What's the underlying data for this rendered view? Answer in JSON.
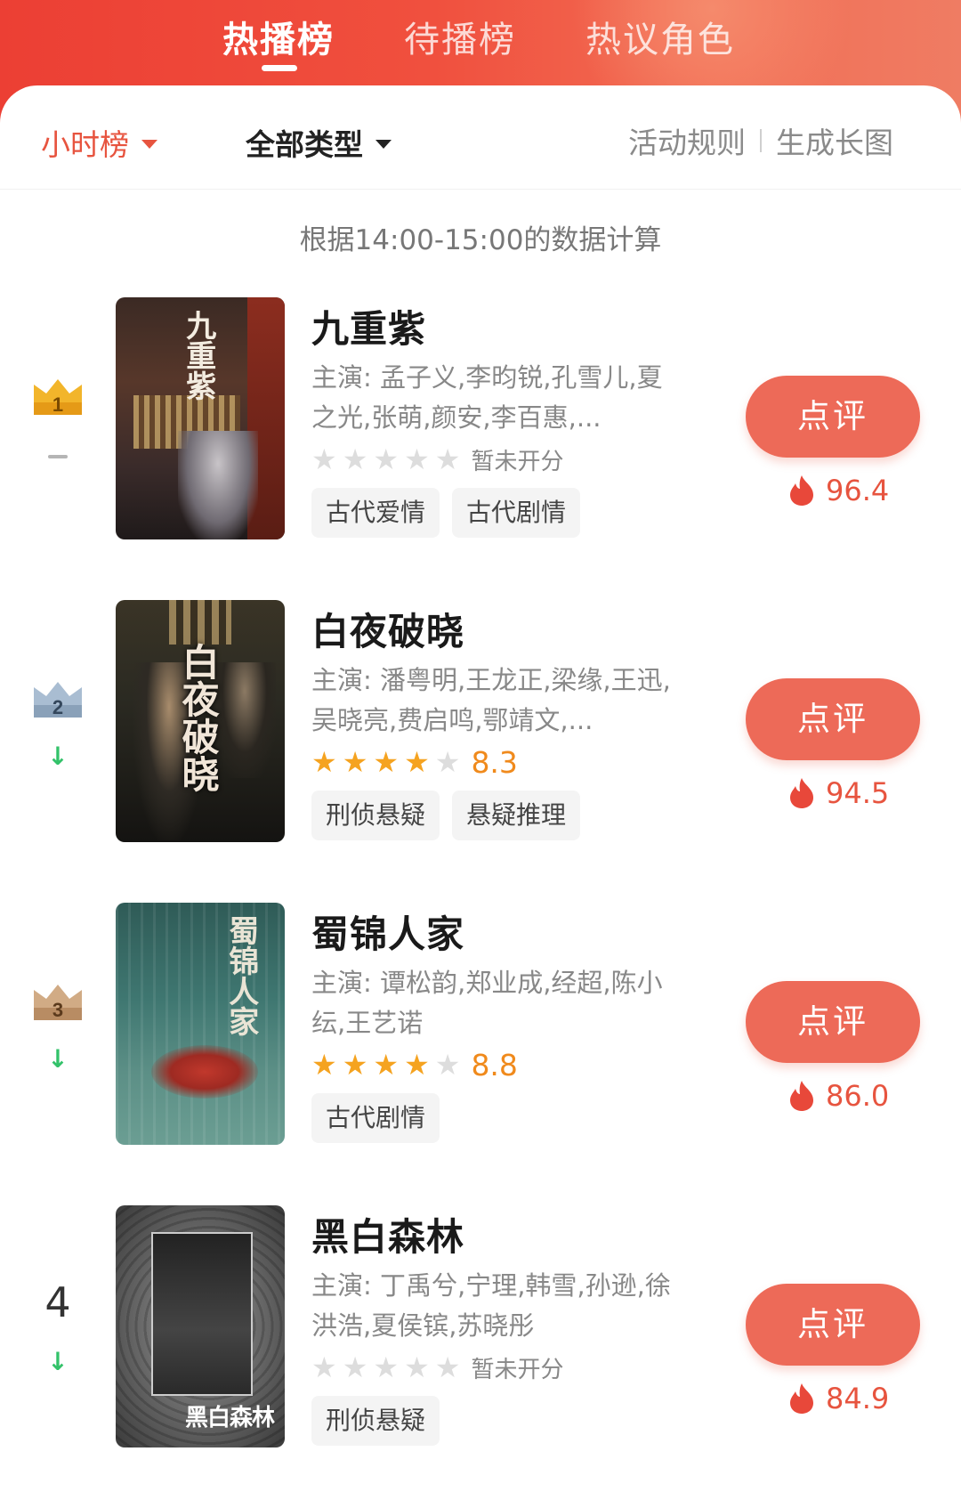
{
  "tabs": [
    {
      "label": "热播榜",
      "active": true
    },
    {
      "label": "待播榜",
      "active": false
    },
    {
      "label": "热议角色",
      "active": false
    }
  ],
  "filters": {
    "period": "小时榜",
    "category": "全部类型",
    "rules_link": "活动规则",
    "long_image_link": "生成长图"
  },
  "note": "根据14:00-15:00的数据计算",
  "items": [
    {
      "rank": "1",
      "trend": "same",
      "title": "九重紫",
      "cast": "主演: 孟子义,李昀锐,孔雪儿,夏之光,张萌,颜安,李百惠,...",
      "stars": 0,
      "score": "暂未开分",
      "rated": false,
      "tags": [
        "古代爱情",
        "古代剧情"
      ],
      "review_label": "点评",
      "heat": "96.4",
      "poster_text": "九重紫"
    },
    {
      "rank": "2",
      "trend": "down",
      "title": "白夜破晓",
      "cast": "主演: 潘粤明,王龙正,梁缘,王迅,吴晓亮,费启鸣,鄂靖文,...",
      "stars": 4,
      "score": "8.3",
      "rated": true,
      "tags": [
        "刑侦悬疑",
        "悬疑推理"
      ],
      "review_label": "点评",
      "heat": "94.5",
      "poster_text": "白夜破晓"
    },
    {
      "rank": "3",
      "trend": "down",
      "title": "蜀锦人家",
      "cast": "主演: 谭松韵,郑业成,经超,陈小纭,王艺诺",
      "stars": 4,
      "score": "8.8",
      "rated": true,
      "tags": [
        "古代剧情"
      ],
      "review_label": "点评",
      "heat": "86.0",
      "poster_text": "蜀锦人家"
    },
    {
      "rank": "4",
      "trend": "down",
      "title": "黑白森林",
      "cast": "主演: 丁禹兮,宁理,韩雪,孙逊,徐洪浩,夏侯镔,苏晓彤",
      "stars": 0,
      "score": "暂未开分",
      "rated": false,
      "tags": [
        "刑侦悬疑"
      ],
      "review_label": "点评",
      "heat": "84.9",
      "poster_text": "黑白森林"
    }
  ],
  "colors": {
    "header_red": "#ec3f34",
    "accent": "#e7543f",
    "button": "#ed6a58",
    "star_on": "#f5a320",
    "score": "#f08a1c",
    "trend_down": "#33c26a",
    "crown_gold": "#f2b52b",
    "crown_silver": "#9fb3c8",
    "crown_bronze": "#c9a27c"
  },
  "icons": {
    "period_caret": "caret-down-icon",
    "category_caret": "caret-down-icon",
    "heat": "flame-icon",
    "rank_1": "crown-gold-icon",
    "rank_2": "crown-silver-icon",
    "rank_3": "crown-bronze-icon",
    "trend_down": "arrow-down-icon",
    "trend_same": "dash-icon"
  }
}
